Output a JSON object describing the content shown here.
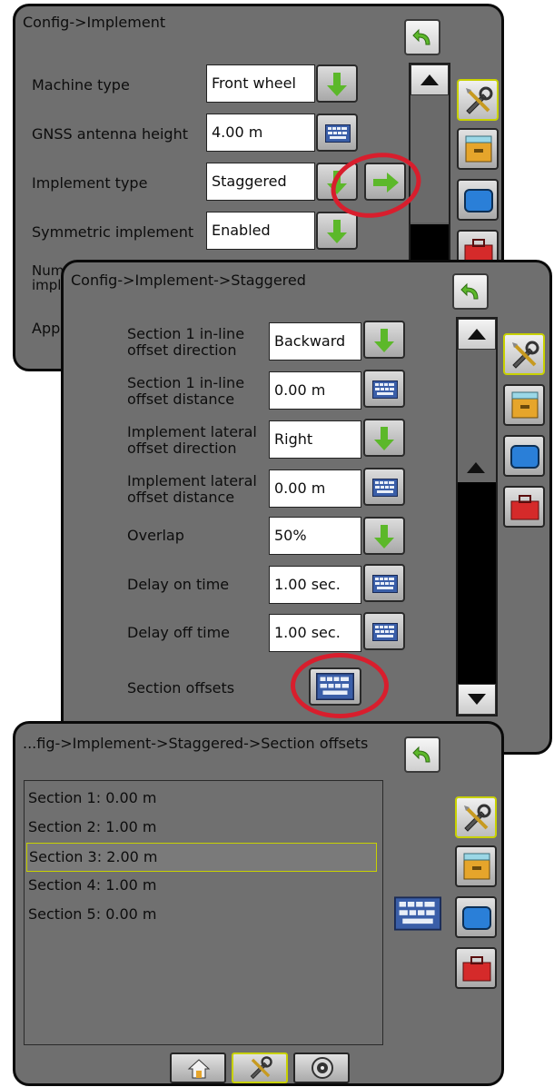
{
  "panel1": {
    "title": "Config->Implement",
    "rows": [
      {
        "label": "Machine type",
        "value": "Front wheel",
        "control": "dropdown"
      },
      {
        "label": "GNSS antenna height",
        "value": "4.00 m",
        "control": "keyboard"
      },
      {
        "label": "Implement type",
        "value": "Staggered",
        "control": "dropdown"
      },
      {
        "label": "Symmetric implement",
        "value": "Enabled",
        "control": "dropdown"
      },
      {
        "label_line1": "Num",
        "label_line2": "impl"
      },
      {
        "label": "App"
      }
    ]
  },
  "panel2": {
    "title": "Config->Implement->Staggered",
    "rows": [
      {
        "label_line1": "Section 1 in-line",
        "label_line2": "offset direction",
        "value": "Backward",
        "control": "dropdown"
      },
      {
        "label_line1": "Section 1 in-line",
        "label_line2": "offset distance",
        "value": "0.00 m",
        "control": "keyboard"
      },
      {
        "label_line1": "Implement lateral",
        "label_line2": "offset direction",
        "value": "Right",
        "control": "dropdown"
      },
      {
        "label_line1": "Implement lateral",
        "label_line2": "offset distance",
        "value": "0.00 m",
        "control": "keyboard"
      },
      {
        "label": "Overlap",
        "value": "50%",
        "control": "dropdown"
      },
      {
        "label": "Delay on time",
        "value": "1.00 sec.",
        "control": "keyboard"
      },
      {
        "label": "Delay off time",
        "value": "1.00 sec.",
        "control": "keyboard"
      },
      {
        "label": "Section offsets",
        "control": "keyboard"
      }
    ]
  },
  "panel3": {
    "title": "...fig->Implement->Staggered->Section offsets",
    "sections": [
      "Section 1: 0.00 m",
      "Section 2: 1.00 m",
      "Section 3: 2.00 m",
      "Section 4: 1.00 m",
      "Section 5: 0.00 m"
    ],
    "selected_index": 2
  },
  "side_tabs": [
    "tools-icon",
    "console-drawer-icon",
    "screen-icon",
    "toolbox-icon"
  ],
  "bottom_tabs": [
    "home-icon",
    "tools-icon",
    "gauge-icon"
  ],
  "colors": {
    "panel_bg": "#6f6f6f",
    "highlight": "#d81e2d",
    "selection": "#c8d100",
    "arrow_green": "#5cb82a"
  }
}
